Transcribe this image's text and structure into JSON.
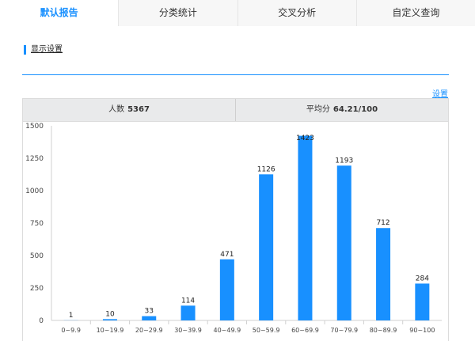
{
  "tabs": [
    {
      "label": "默认报告",
      "active": true
    },
    {
      "label": "分类统计",
      "active": false
    },
    {
      "label": "交叉分析",
      "active": false
    },
    {
      "label": "自定义查询",
      "active": false
    }
  ],
  "settings": {
    "title": "显示设置",
    "link_label": "设置"
  },
  "stats": {
    "count_label": "人数",
    "count_value": "5367",
    "avg_label": "平均分",
    "avg_value": "64.21/100"
  },
  "colors": {
    "accent": "#1890ff",
    "bar": "#1890ff"
  },
  "chart_data": {
    "type": "bar",
    "categories": [
      "0~9.9",
      "10~19.9",
      "20~29.9",
      "30~39.9",
      "40~49.9",
      "50~59.9",
      "60~69.9",
      "70~79.9",
      "80~89.9",
      "90~100"
    ],
    "values": [
      1,
      10,
      33,
      114,
      471,
      1126,
      1423,
      1193,
      712,
      284
    ],
    "yticks": [
      0,
      250,
      500,
      750,
      1000,
      1250,
      1500
    ],
    "ylim": [
      0,
      1500
    ],
    "title": "",
    "xlabel": "",
    "ylabel": "",
    "grid": false
  }
}
